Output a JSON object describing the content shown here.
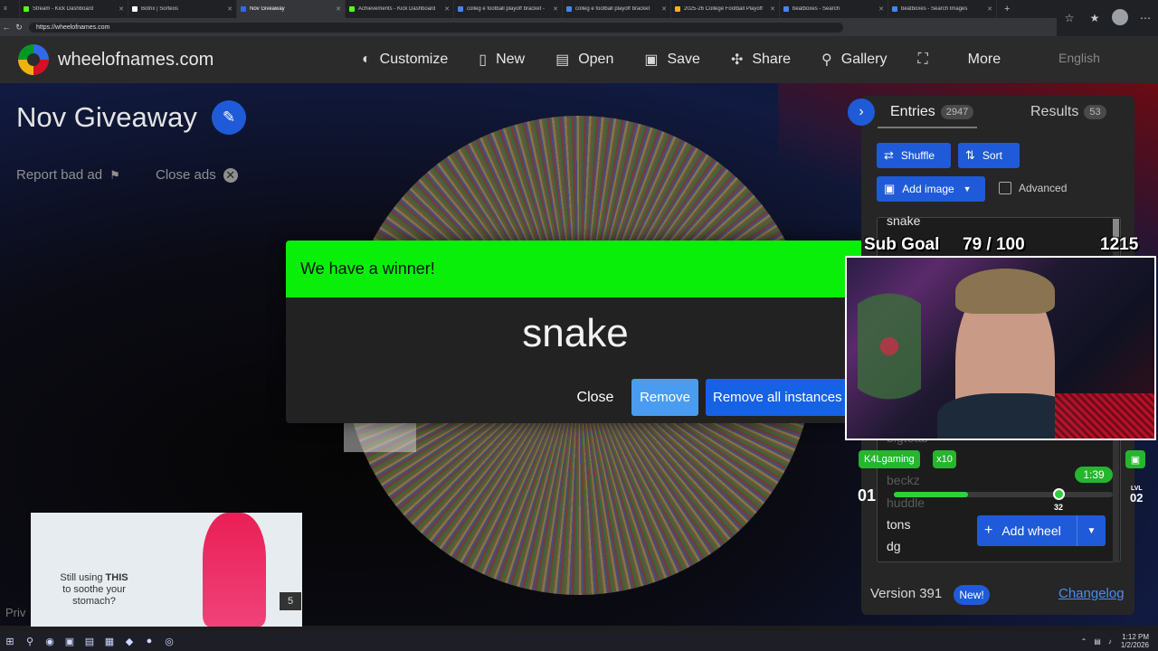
{
  "browser": {
    "tabs": [
      {
        "label": "Stream - Kick Dashboard",
        "color": "#53fc18"
      },
      {
        "label": "Botrix | Sorteos",
        "color": "#ffffff"
      },
      {
        "label": "Nov Giveaway",
        "color": "#3369e8",
        "active": true
      },
      {
        "label": "Achievements - Kick Dashboard",
        "color": "#53fc18"
      },
      {
        "label": "colleg e football playoff bracket -",
        "color": "#4285f4"
      },
      {
        "label": "colleg e football playoff bracket",
        "color": "#4285f4"
      },
      {
        "label": "2025-26 College Football Playoff",
        "color": "#f4b400"
      },
      {
        "label": "beatboxes - Search",
        "color": "#4285f4"
      },
      {
        "label": "beatboxes - Search Images",
        "color": "#4285f4"
      }
    ],
    "url": "https://wheelofnames.com"
  },
  "app": {
    "site_name": "wheelofnames.com",
    "menu": [
      {
        "label": "Customize",
        "icon": "palette-icon"
      },
      {
        "label": "New",
        "icon": "file-icon"
      },
      {
        "label": "Open",
        "icon": "folder-icon"
      },
      {
        "label": "Save",
        "icon": "floppy-icon"
      },
      {
        "label": "Share",
        "icon": "share-icon"
      },
      {
        "label": "Gallery",
        "icon": "search-icon"
      },
      {
        "label": "",
        "icon": "fullscreen-icon"
      },
      {
        "label": "More",
        "icon": ""
      }
    ],
    "language": "English"
  },
  "wheel": {
    "title": "Nov Giveaway",
    "report_ad": "Report bad ad",
    "close_ads": "Close ads"
  },
  "modal": {
    "header": "We have a winner!",
    "winner": "snake",
    "close_label": "Close",
    "remove_label": "Remove",
    "remove_all_label": "Remove all instances",
    "header_color": "#0aef0a"
  },
  "panel": {
    "entries_label": "Entries",
    "entries_count": "2947",
    "results_label": "Results",
    "results_count": "53",
    "shuffle_label": "Shuffle",
    "sort_label": "Sort",
    "add_image_label": "Add image",
    "advanced_label": "Advanced",
    "entries": [
      "snake",
      "bigteab",
      "beckz",
      "huddle",
      "tons",
      "dg"
    ],
    "add_wheel_label": "Add wheel",
    "version_label": "Version 391",
    "new_badge": "New!",
    "changelog_label": "Changelog"
  },
  "overlay": {
    "sub_goal_label": "Sub Goal",
    "sub_goal_value": "79 / 100",
    "sub_total": "1215",
    "chatter": "K4Lgaming",
    "multiplier": "x10",
    "timer": "1:39",
    "level_current": "01",
    "level_next_label": "LVL",
    "level_next": "02",
    "xp_value": "32",
    "xp_fraction": 0.75
  },
  "ad": {
    "text_pre": "Still using ",
    "text_bold": "THIS",
    "text_post": " to soothe your stomach?",
    "count": "5",
    "priv_label": "Priv"
  },
  "taskbar": {
    "time": "1:12 PM",
    "date": "1/2/2026"
  }
}
